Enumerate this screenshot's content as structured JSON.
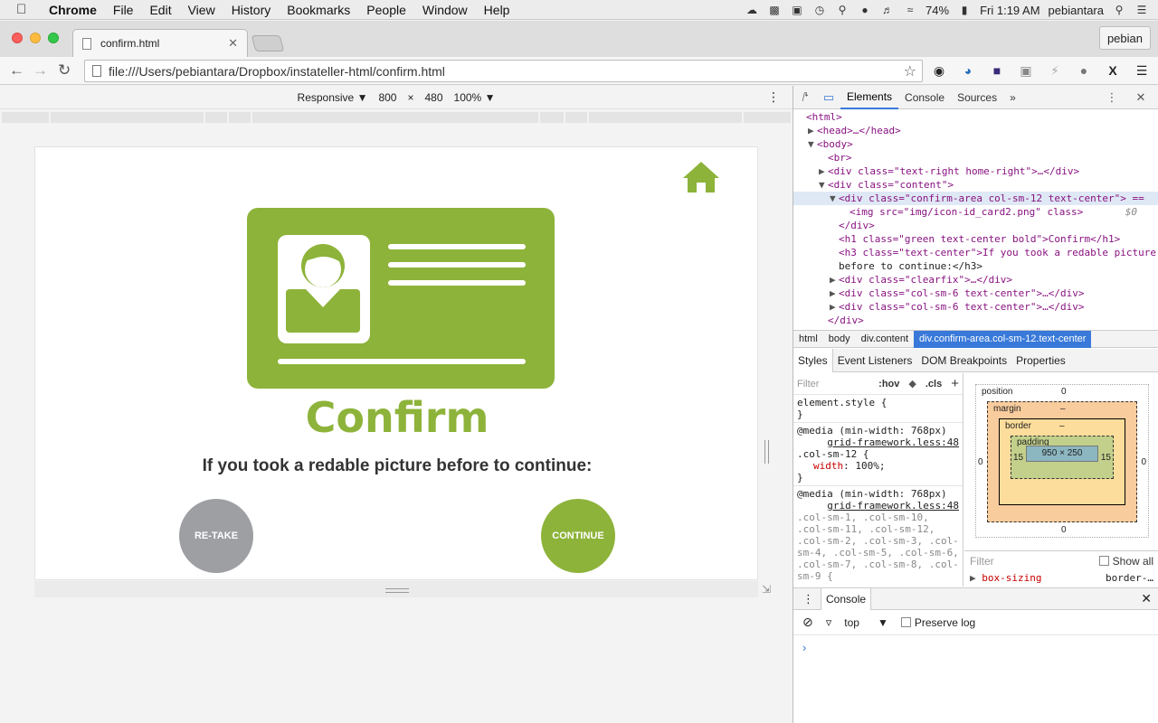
{
  "menubar": {
    "app": "Chrome",
    "items": [
      "File",
      "Edit",
      "View",
      "History",
      "Bookmarks",
      "People",
      "Window",
      "Help"
    ],
    "battery": "74%",
    "clock": "Fri 1:19 AM",
    "user": "pebiantara"
  },
  "browser": {
    "tab_title": "confirm.html",
    "profile": "pebian",
    "url": "file:///Users/pebiantara/Dropbox/instateller-html/confirm.html"
  },
  "device_toolbar": {
    "mode": "Responsive",
    "width": "800",
    "times": "×",
    "height": "480",
    "zoom": "100%"
  },
  "page": {
    "title": "Confirm",
    "subtitle": "If you took a redable picture before to continue:",
    "retake_label": "RE-TAKE",
    "continue_label": "CONTINUE",
    "colors": {
      "green": "#8db33a",
      "gray": "#9d9fa3"
    }
  },
  "devtools": {
    "tabs": [
      "Elements",
      "Console",
      "Sources"
    ],
    "more": "»",
    "dom": [
      "<html>",
      "<head>…</head>",
      "<body>",
      "<br>",
      "<div class=\"text-right home-right\">…</div>",
      "<div class=\"content\">",
      "<div class=\"confirm-area col-sm-12 text-center\"> ==",
      "<img src=\"img/icon-id_card2.png\" class>",
      "</div>",
      "<h1 class=\"green text-center bold\">Confirm</h1>",
      "<h3 class=\"text-center\">If you took a redable picture",
      "before to continue:</h3>",
      "<div class=\"clearfix\">…</div>",
      "<div class=\"col-sm-6 text-center\">…</div>",
      "<div class=\"col-sm-6 text-center\">…</div>",
      "</div>"
    ],
    "dollar0": "$0",
    "breadcrumbs": [
      "html",
      "body",
      "div.content",
      "div.confirm-area.col-sm-12.text-center"
    ],
    "style_tabs": [
      "Styles",
      "Event Listeners",
      "DOM Breakpoints",
      "Properties"
    ],
    "filter_placeholder": "Filter",
    "hov": ":hov",
    "cls": ".cls",
    "plus": "+",
    "rules": [
      {
        "line1": "element.style {",
        "line2": "}"
      },
      {
        "media": "@media (min-width: 768px)",
        "src": "grid-framework.less:48",
        "selector": ".col-sm-12 {",
        "prop": "width",
        "value": "100%;",
        "close": "}"
      },
      {
        "media": "@media (min-width: 768px)",
        "src": "grid-framework.less:48",
        "selector": ".col-sm-1, .col-sm-10, .col-sm-11, .col-sm-12, .col-sm-2, .col-sm-3, .col-sm-4, .col-sm-5, .col-sm-6, .col-sm-7, .col-sm-8, .col-sm-9 {"
      }
    ],
    "boxmodel": {
      "position_label": "position",
      "position_val": "0",
      "margin_label": "margin",
      "border_label": "border",
      "padding_label": "padding",
      "dash": "–",
      "side_val": "0",
      "pad_side": "15",
      "content": "950 × 250",
      "bottom_val": "0"
    },
    "box_filter": "Filter",
    "show_all": "Show all",
    "box_sizing_prop": "box-sizing",
    "box_sizing_val": "border-…",
    "console": {
      "tab": "Console",
      "context": "top",
      "preserve_log": "Preserve log",
      "prompt": "›"
    }
  }
}
